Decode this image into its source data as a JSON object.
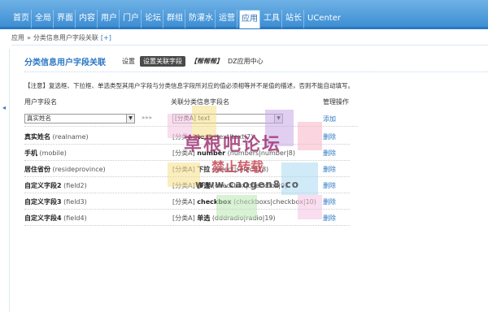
{
  "nav": {
    "tabs": [
      "首页",
      "全局",
      "界面",
      "内容",
      "用户",
      "门户",
      "论坛",
      "群组",
      "防灌水",
      "运营",
      "应用",
      "工具",
      "站长",
      "UCenter"
    ],
    "active_index": 10
  },
  "breadcrumb": {
    "items": [
      "应用",
      "»",
      "分类信息用户字段关联"
    ],
    "add": "[+]"
  },
  "page": {
    "title": "分类信息用户字段关联",
    "subtabs": {
      "settings": "设置",
      "relation": "设置关联字段",
      "help": "【帮帮帮】",
      "center": "DZ应用中心"
    }
  },
  "notice": "【注意】复选框、下拉框、单选类型其用户字段与分类信息字段所对应的值必须相等并不是值的描述，否则不能自动填写。",
  "table": {
    "headers": {
      "user_field": "用户字段名",
      "cat_field": "关联分类信息字段名",
      "ops": "管理操作"
    },
    "new_row": {
      "user_select": "真实姓名",
      "arrows": "»»»",
      "cat_select": "[分类A] text",
      "add": "添加"
    },
    "rows": [
      {
        "name": "真实姓名",
        "key": "(realname)",
        "cat_prefix": "[分类A]",
        "cat_name": "text",
        "cat_detail": "(text|text|7)",
        "op": "删除"
      },
      {
        "name": "手机",
        "key": "(mobile)",
        "cat_prefix": "[分类A]",
        "cat_name": "number",
        "cat_detail": "(numbers|number|8)",
        "op": "删除"
      },
      {
        "name": "居住省份",
        "key": "(resideprovince)",
        "cat_prefix": "[分类A]",
        "cat_name": "下拉",
        "cat_detail": "(select|select|18)",
        "op": "删除"
      },
      {
        "name": "自定义字段2",
        "key": "(field2)",
        "cat_prefix": "[分类A]",
        "cat_name": "多选",
        "cat_detail": "(checkbox|checkbox|9)",
        "op": "删除"
      },
      {
        "name": "自定义字段3",
        "key": "(field3)",
        "cat_prefix": "[分类A]",
        "cat_name": "checkbox",
        "cat_detail": "(checkboxs|checkbox|10)",
        "op": "删除"
      },
      {
        "name": "自定义字段4",
        "key": "(field4)",
        "cat_prefix": "[分类A]",
        "cat_name": "单选",
        "cat_detail": "(dddradio|radio|19)",
        "op": "删除"
      }
    ]
  },
  "watermark": {
    "line1": "草根吧论坛",
    "line2": "禁止转载",
    "line3": "www.caogen8.co"
  }
}
